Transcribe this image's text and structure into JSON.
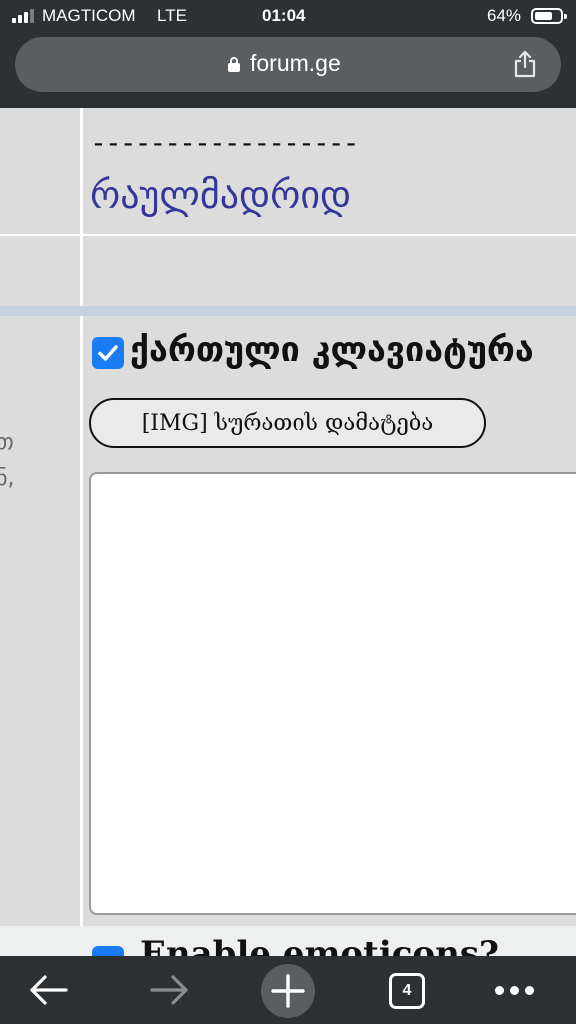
{
  "status_bar": {
    "carrier": "MAGTICOM",
    "network": "LTE",
    "time": "01:04",
    "battery_percent": "64%",
    "battery_level": 0.64
  },
  "url_bar": {
    "domain": "forum.ge",
    "lock_icon": "lock-icon",
    "share_icon": "share-icon"
  },
  "post": {
    "separator": "------------------",
    "username": "რაულმადრიდ"
  },
  "sidebar": {
    "fragment_1": "თ",
    "fragment_2": "ნ,"
  },
  "editor": {
    "georgian_keyboard_checked": true,
    "georgian_keyboard_label": "ქართული კლავიატურა",
    "img_button_label": "[IMG] სურათის დამატება",
    "message_value": "",
    "enable_emoticons_checked": true,
    "enable_emoticons_label": "Enable emoticons?"
  },
  "toolbar": {
    "back_icon": "arrow-left-icon",
    "forward_icon": "arrow-right-icon",
    "new_tab_icon": "plus-icon",
    "tab_count": "4",
    "more_icon": "more-dots-icon"
  },
  "colors": {
    "chrome": "#2d3134",
    "url_pill": "#5a5e61",
    "username_link": "#343699",
    "checkbox_blue": "#1a7cf5"
  }
}
